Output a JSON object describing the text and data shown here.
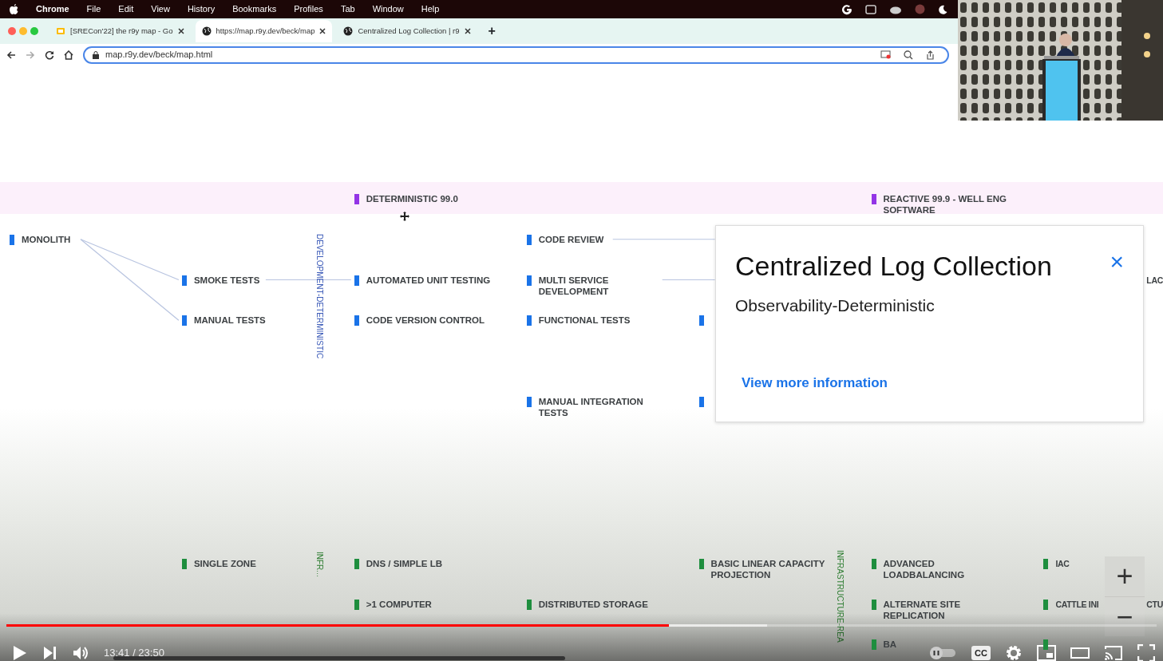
{
  "menu_bar": {
    "app": "Chrome",
    "items": [
      "File",
      "Edit",
      "View",
      "History",
      "Bookmarks",
      "Profiles",
      "Tab",
      "Window",
      "Help"
    ]
  },
  "tabs": [
    {
      "title": "[SRECon'22] the r9y map - Go",
      "selected": false
    },
    {
      "title": "https://map.r9y.dev/beck/map",
      "selected": true
    },
    {
      "title": "Centralized Log Collection | r9",
      "selected": false
    }
  ],
  "new_tab": "+",
  "address_bar": {
    "url": "map.r9y.dev/beck/map.html"
  },
  "map": {
    "nodes": [
      {
        "label": "DETERMINISTIC 99.0",
        "color": "#9334e6"
      },
      {
        "label": "REACTIVE 99.9 - WELL ENG SOFTWARE",
        "color": "#9334e6"
      },
      {
        "label": "MONOLITH",
        "color": "#1a73e8"
      },
      {
        "label": "SMOKE TESTS",
        "color": "#1a73e8"
      },
      {
        "label": "MANUAL TESTS",
        "color": "#1a73e8"
      },
      {
        "label": "AUTOMATED UNIT TESTING",
        "color": "#1a73e8"
      },
      {
        "label": "CODE VERSION CONTROL",
        "color": "#1a73e8"
      },
      {
        "label": "CODE REVIEW",
        "color": "#1a73e8"
      },
      {
        "label": "MULTI SERVICE DEVELOPMENT",
        "color": "#1a73e8"
      },
      {
        "label": "FUNCTIONAL TESTS",
        "color": "#1a73e8"
      },
      {
        "label": "MANUAL INTEGRATION TESTS",
        "color": "#1a73e8"
      },
      {
        "color": "#1a73e8"
      },
      {
        "color": "#1a73e8"
      },
      {
        "label": "SINGLE ZONE",
        "color": "#1e8e3e"
      },
      {
        "label": "DNS / SIMPLE LB",
        "color": "#1e8e3e"
      },
      {
        "label": ">1 COMPUTER",
        "color": "#1e8e3e"
      },
      {
        "label": "DISTRIBUTED STORAGE",
        "color": "#1e8e3e"
      },
      {
        "label": "BASIC LINEAR CAPACITY PROJECTION",
        "color": "#1e8e3e"
      },
      {
        "label": "ADVANCED LOADBALANCING",
        "color": "#1e8e3e"
      },
      {
        "label": "ALTERNATE SITE REPLICATION",
        "color": "#1e8e3e"
      },
      {
        "label": "BA",
        "color": "#1e8e3e"
      },
      {
        "label": "IAC",
        "color": "#1e8e3e"
      },
      {
        "label": "CATTLE INI",
        "color": "#1e8e3e"
      },
      {
        "color": "#1e8e3e"
      }
    ],
    "section_labels": [
      {
        "text": "DEVELOPMENT-DETERMINISTIC",
        "color": "#3c5bb8"
      },
      {
        "text": "INFR...",
        "color": "#2e7d32"
      },
      {
        "text": "INFRASTRUCTURE-REA",
        "color": "#2e7d32"
      }
    ],
    "edge_fragments": [
      "LAC",
      "CTU"
    ]
  },
  "popup": {
    "title": "Centralized Log Collection",
    "subtitle": "Observability-Deterministic",
    "link": "View more information",
    "close": "×"
  },
  "zoom_controls": [
    "+",
    "−"
  ],
  "player": {
    "progress": {
      "level": 0.576
    },
    "buffer": {
      "level": 0.661
    },
    "time": "13:41 / 23:50",
    "autoplay": {
      "on": false
    },
    "captions": "CC"
  }
}
